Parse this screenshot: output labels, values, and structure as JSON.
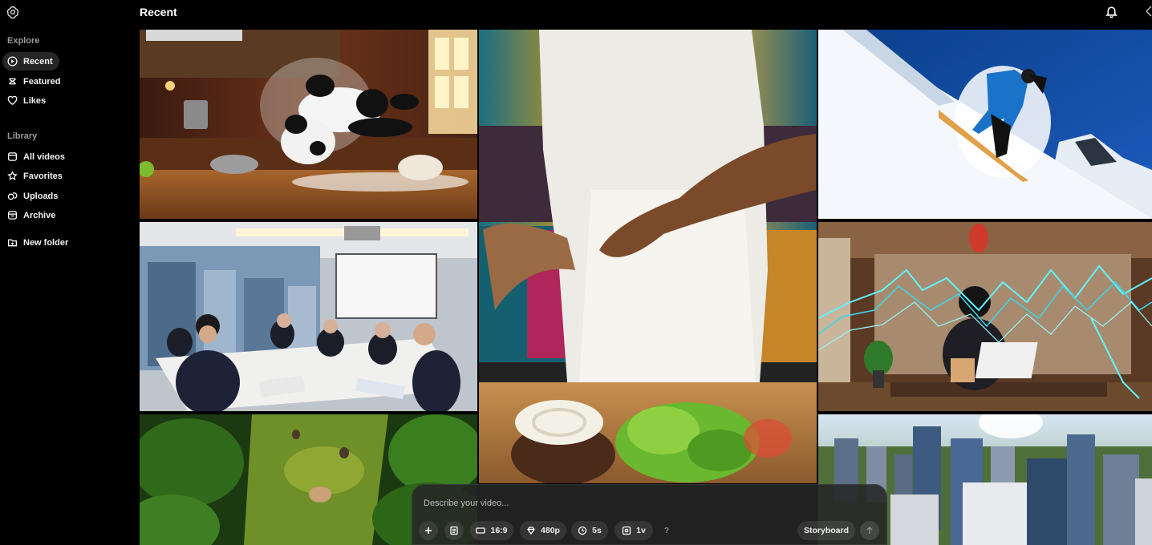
{
  "header": {
    "title": "Recent"
  },
  "sidebar": {
    "explore_title": "Explore",
    "explore_items": [
      {
        "label": "Recent",
        "icon": "play-circle-icon",
        "active": true
      },
      {
        "label": "Featured",
        "icon": "featured-icon"
      },
      {
        "label": "Likes",
        "icon": "heart-icon"
      }
    ],
    "library_title": "Library",
    "library_items": [
      {
        "label": "All videos",
        "icon": "videos-icon"
      },
      {
        "label": "Favorites",
        "icon": "star-icon"
      },
      {
        "label": "Uploads",
        "icon": "uploads-icon"
      },
      {
        "label": "Archive",
        "icon": "archive-icon"
      }
    ],
    "new_folder": {
      "label": "New folder",
      "icon": "new-folder-icon"
    }
  },
  "composer": {
    "placeholder": "Describe your video...",
    "aspect_ratio": "16:9",
    "resolution": "480p",
    "duration": "5s",
    "variations": "1v",
    "help": "?",
    "storyboard": "Storyboard"
  },
  "colors": {
    "background": "#000000",
    "active_nav": "#262626",
    "composer_bg": "#262626"
  }
}
